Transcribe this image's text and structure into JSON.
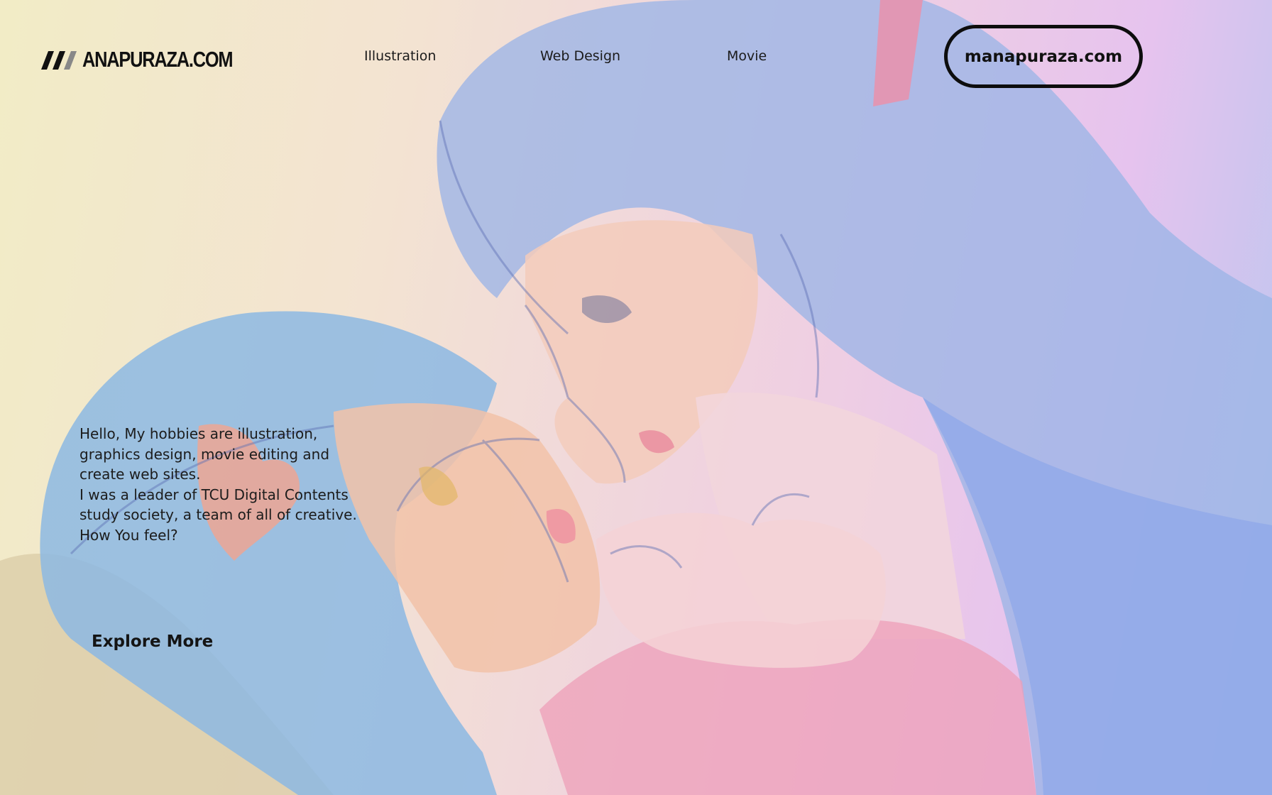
{
  "brand": {
    "logo_text": "ANAPURAZA.COM",
    "logo_icon": "three-slanted-bars-m-icon"
  },
  "nav": {
    "items": [
      {
        "label": "Illustration"
      },
      {
        "label": "Web Design"
      },
      {
        "label": "Movie"
      }
    ],
    "cta_label": "manapuraza.com"
  },
  "hero": {
    "intro_lines": [
      "Hello, My hobbies are illustration,",
      "graphics design, movie editing and",
      "create web sites.",
      "I was a leader of TCU Digital Contents",
      "study society, a team of all of creative.",
      "How You feel?"
    ],
    "explore_label": "Explore More",
    "background": "anime-illustration-two-blue-haired-girls"
  },
  "colors": {
    "text": "#141414",
    "gradient_left": "#f2ecc6",
    "gradient_mid": "#efcfe2",
    "gradient_right": "#b9c6ef",
    "hair_blue": "#8fb7e6",
    "skin_peach": "#f4c6b2"
  }
}
